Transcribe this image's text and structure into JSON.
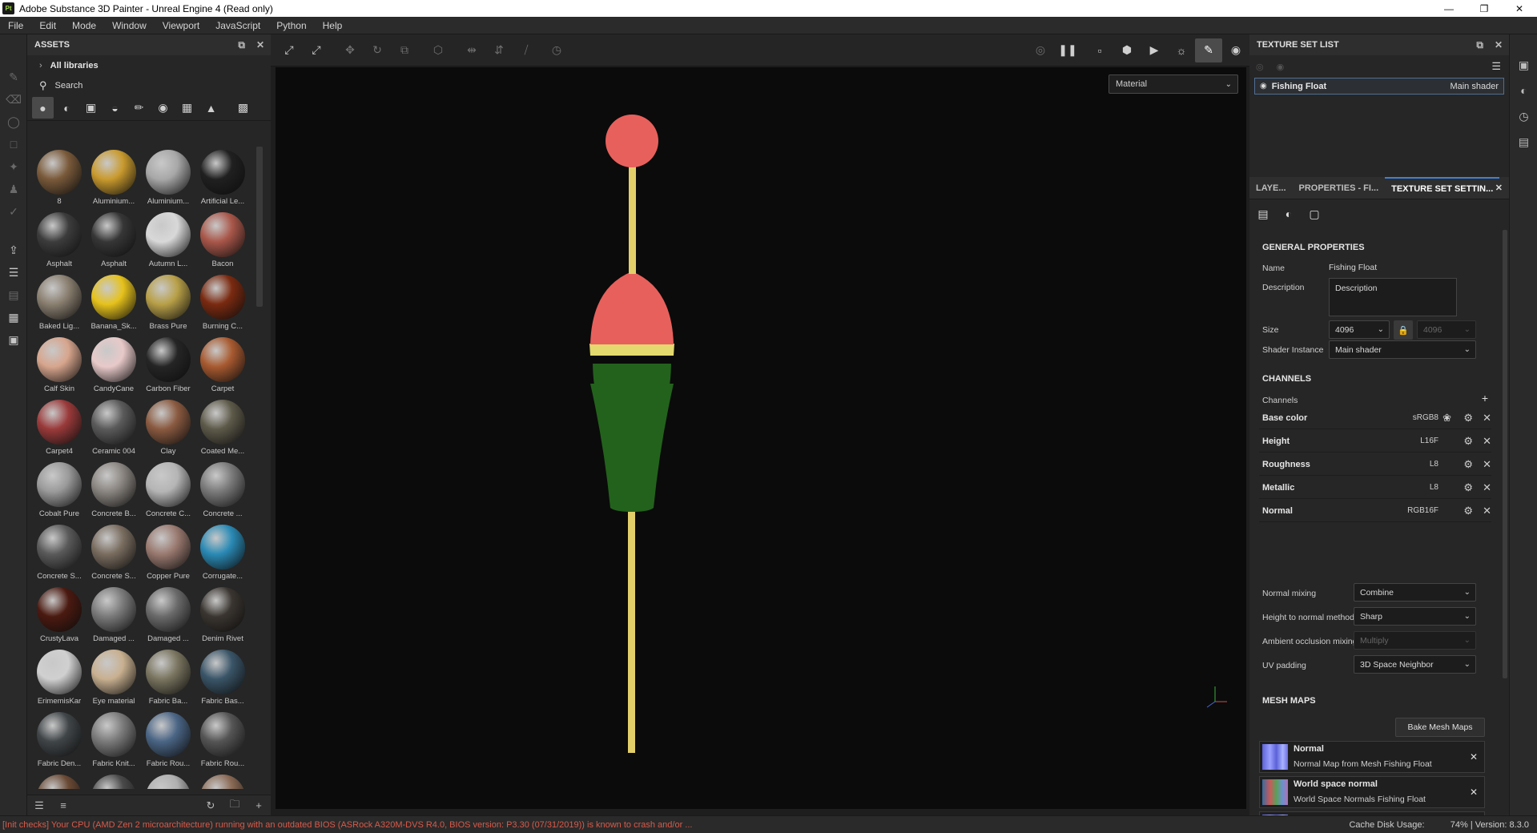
{
  "window": {
    "app_icon": "Pt",
    "title": "Adobe Substance 3D Painter - Unreal Engine 4 (Read only)",
    "controls": [
      "minimize-icon",
      "restore-icon",
      "close-icon"
    ]
  },
  "menu": [
    "File",
    "Edit",
    "Mode",
    "Window",
    "Viewport",
    "JavaScript",
    "Python",
    "Help"
  ],
  "assets": {
    "title": "ASSETS",
    "library": "All libraries",
    "search_placeholder": "Search",
    "items": [
      {
        "name": "8",
        "color": "#7a5a3a"
      },
      {
        "name": "Aluminium...",
        "color": "#c99a2e"
      },
      {
        "name": "Aluminium...",
        "color": "#a8a8a8"
      },
      {
        "name": "Artificial Le...",
        "color": "#202020"
      },
      {
        "name": "Asphalt",
        "color": "#3c3c3c"
      },
      {
        "name": "Asphalt",
        "color": "#363636"
      },
      {
        "name": "Autumn L...",
        "color": "#d8d8d8"
      },
      {
        "name": "Bacon",
        "color": "#a9574a"
      },
      {
        "name": "Baked Lig...",
        "color": "#8a7f70"
      },
      {
        "name": "Banana_Sk...",
        "color": "#e6c21c"
      },
      {
        "name": "Brass Pure",
        "color": "#b8a048"
      },
      {
        "name": "Burning C...",
        "color": "#7a2a10"
      },
      {
        "name": "Calf Skin",
        "color": "#d7a58d"
      },
      {
        "name": "CandyCane",
        "color": "#e8c9c9"
      },
      {
        "name": "Carbon Fiber",
        "color": "#252525"
      },
      {
        "name": "Carpet",
        "color": "#a85a30"
      },
      {
        "name": "Carpet4",
        "color": "#9a3a3a"
      },
      {
        "name": "Ceramic 004",
        "color": "#5a5a5a"
      },
      {
        "name": "Clay",
        "color": "#8a5a40"
      },
      {
        "name": "Coated Me...",
        "color": "#5e5a4a"
      },
      {
        "name": "Cobalt Pure",
        "color": "#9a9a9a"
      },
      {
        "name": "Concrete B...",
        "color": "#8a8580"
      },
      {
        "name": "Concrete C...",
        "color": "#b5b5b5"
      },
      {
        "name": "Concrete ...",
        "color": "#7a7a7a"
      },
      {
        "name": "Concrete S...",
        "color": "#5a5a5a"
      },
      {
        "name": "Concrete S...",
        "color": "#7a6d60"
      },
      {
        "name": "Copper Pure",
        "color": "#9a7a70"
      },
      {
        "name": "Corrugate...",
        "color": "#2a8ab5"
      },
      {
        "name": "CrustyLava",
        "color": "#4a1a10"
      },
      {
        "name": "Damaged ...",
        "color": "#7a7a7a"
      },
      {
        "name": "Damaged ...",
        "color": "#6a6a6a"
      },
      {
        "name": "Denim Rivet",
        "color": "#3a3530"
      },
      {
        "name": "ErimemisKar",
        "color": "#d0d0d0"
      },
      {
        "name": "Eye material",
        "color": "#c8b090"
      },
      {
        "name": "Fabric Ba...",
        "color": "#7a7560"
      },
      {
        "name": "Fabric Bas...",
        "color": "#3a5568"
      },
      {
        "name": "Fabric Den...",
        "color": "#404548"
      },
      {
        "name": "Fabric Knit...",
        "color": "#7a7a7a"
      },
      {
        "name": "Fabric Rou...",
        "color": "#4a6585"
      },
      {
        "name": "Fabric Rou...",
        "color": "#555555"
      },
      {
        "name": "",
        "color": "#6a4a35"
      },
      {
        "name": "",
        "color": "#4a4a4a"
      },
      {
        "name": "",
        "color": "#b0b0b0"
      },
      {
        "name": "",
        "color": "#8a6a55"
      }
    ]
  },
  "viewport": {
    "mode_dropdown": "Material"
  },
  "texture_set_list": {
    "title": "TEXTURE SET LIST",
    "item_name": "Fishing Float",
    "item_shader": "Main shader"
  },
  "tabs": [
    "LAYE...",
    "PROPERTIES - FI...",
    "TEXTURE SET SETTIN..."
  ],
  "texture_set_settings": {
    "general_title": "GENERAL PROPERTIES",
    "name_label": "Name",
    "name_value": "Fishing Float",
    "description_label": "Description",
    "description_value": "Description",
    "size_label": "Size",
    "size_value": "4096",
    "size_value_locked": "4096",
    "shader_instance_label": "Shader Instance",
    "shader_instance_value": "Main shader",
    "channels_title": "CHANNELS",
    "channels_label": "Channels",
    "channels": [
      {
        "name": "Base color",
        "format": "sRGB8"
      },
      {
        "name": "Height",
        "format": "L16F"
      },
      {
        "name": "Roughness",
        "format": "L8"
      },
      {
        "name": "Metallic",
        "format": "L8"
      },
      {
        "name": "Normal",
        "format": "RGB16F"
      }
    ],
    "normal_mixing_label": "Normal mixing",
    "normal_mixing_value": "Combine",
    "height_to_normal_label": "Height to normal method",
    "height_to_normal_value": "Sharp",
    "ao_mixing_label": "Ambient occlusion mixing",
    "ao_mixing_value": "Multiply",
    "uv_padding_label": "UV padding",
    "uv_padding_value": "3D Space Neighbor",
    "mesh_maps_title": "MESH MAPS",
    "bake_button": "Bake Mesh Maps",
    "mesh_maps": [
      {
        "title": "Normal",
        "subtitle": "Normal Map from Mesh Fishing Float"
      },
      {
        "title": "World space normal",
        "subtitle": "World Space Normals Fishing Float"
      }
    ]
  },
  "status": {
    "message": "[Init checks] Your CPU (AMD Zen 2 microarchitecture) running with an outdated BIOS (ASRock A320M-DVS R4.0, BIOS version: P3.30 (07/31/2019)) is known to crash and/or ...",
    "cache_label": "Cache Disk Usage:",
    "cache_value": "74%",
    "version": "| Version: 8.3.0"
  }
}
